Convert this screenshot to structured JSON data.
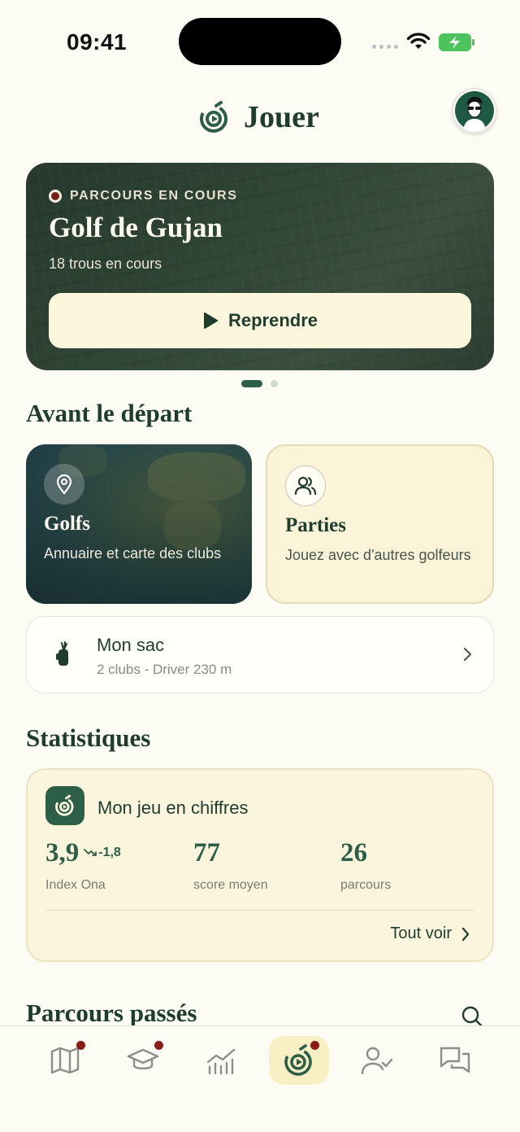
{
  "status_bar": {
    "time": "09:41"
  },
  "header": {
    "title": "Jouer"
  },
  "current_round": {
    "badge": "PARCOURS EN COURS",
    "course": "Golf de Gujan",
    "subtitle": "18 trous en cours",
    "resume_label": "Reprendre"
  },
  "before_start": {
    "title": "Avant le départ",
    "golfs": {
      "name": "Golfs",
      "description": "Annuaire et carte des clubs"
    },
    "parties": {
      "name": "Parties",
      "description": "Jouez avec d'autres golfeurs"
    },
    "bag": {
      "name": "Mon sac",
      "description": "2 clubs - Driver 230 m"
    }
  },
  "stats": {
    "title": "Statistiques",
    "card_title": "Mon jeu en chiffres",
    "index": {
      "value": "3,9",
      "delta": "-1,8",
      "label": "Index Ona"
    },
    "avg_score": {
      "value": "77",
      "label": "score moyen"
    },
    "rounds": {
      "value": "26",
      "label": "parcours"
    },
    "see_all": "Tout voir"
  },
  "past_rounds": {
    "title": "Parcours passés"
  },
  "colors": {
    "primary": "#2d5e48",
    "cream": "#fcf6dc",
    "notif": "#8a1c18"
  },
  "bottom_nav": [
    "map-icon",
    "graduation-cap-icon",
    "stats-icon",
    "play-target-icon",
    "user-check-icon",
    "chat-icon"
  ]
}
